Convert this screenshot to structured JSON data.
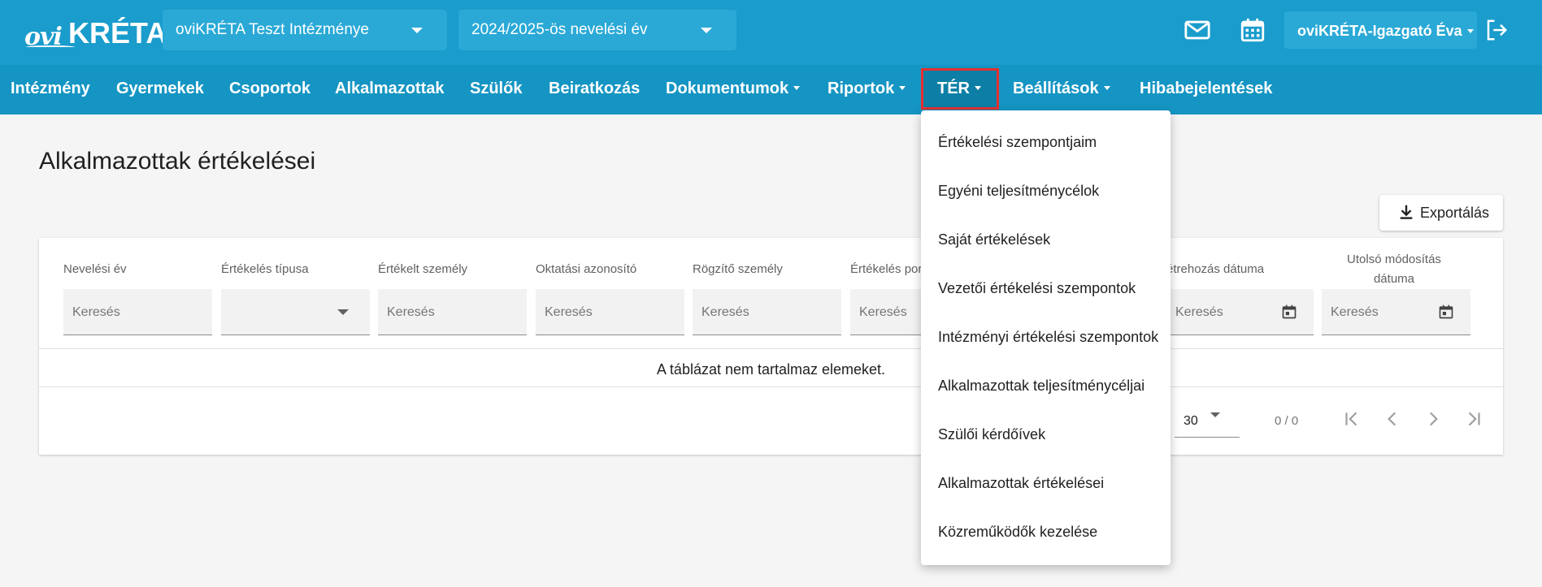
{
  "app": {
    "logo_ovi": "ovi",
    "logo_kreta": "KRÉTA",
    "institution": "oviKRÉTA Teszt Intézménye",
    "school_year": "2024/2025-ös nevelési év",
    "user": "oviKRÉTA-Igazgató Éva",
    "icons": [
      "mail-icon",
      "calendar-icon",
      "logout-icon"
    ]
  },
  "nav": {
    "items": [
      "Intézmény",
      "Gyermekek",
      "Csoportok",
      "Alkalmazottak",
      "Szülők",
      "Beiratkozás",
      "Dokumentumok",
      "Riportok",
      "TÉR",
      "Beállítások",
      "Hibabejelentések"
    ],
    "active": "TÉR"
  },
  "dropdown": {
    "items": [
      "Értékelési szempontjaim",
      "Egyéni teljesítménycélok",
      "Saját értékelések",
      "Vezetői értékelési szempontok",
      "Intézményi értékelési szempontok",
      "Alkalmazottak teljesítménycéljai",
      "Szülői kérdőívek",
      "Alkalmazottak értékelései",
      "Közreműködők kezelése"
    ]
  },
  "page": {
    "title": "Alkalmazottak értékelései",
    "export_label": "Exportálás"
  },
  "table": {
    "columns": [
      "Nevelési év",
      "Értékelés típusa",
      "Értékelt személy",
      "Oktatási azonosító",
      "Rögzítő személy",
      "Értékelés por",
      "étrehozás dátuma",
      "Utolsó módosítás",
      "dátuma"
    ],
    "search_placeholder": "Keresés",
    "empty_message": "A táblázat nem tartalmaz elemeket.",
    "page_size": "30",
    "page_info": "0 / 0"
  },
  "colors": {
    "topbar": "#1a9ccc",
    "navbar": "#1595c3",
    "active_tab": "#0d7fa6",
    "highlight_border": "#e53030"
  }
}
